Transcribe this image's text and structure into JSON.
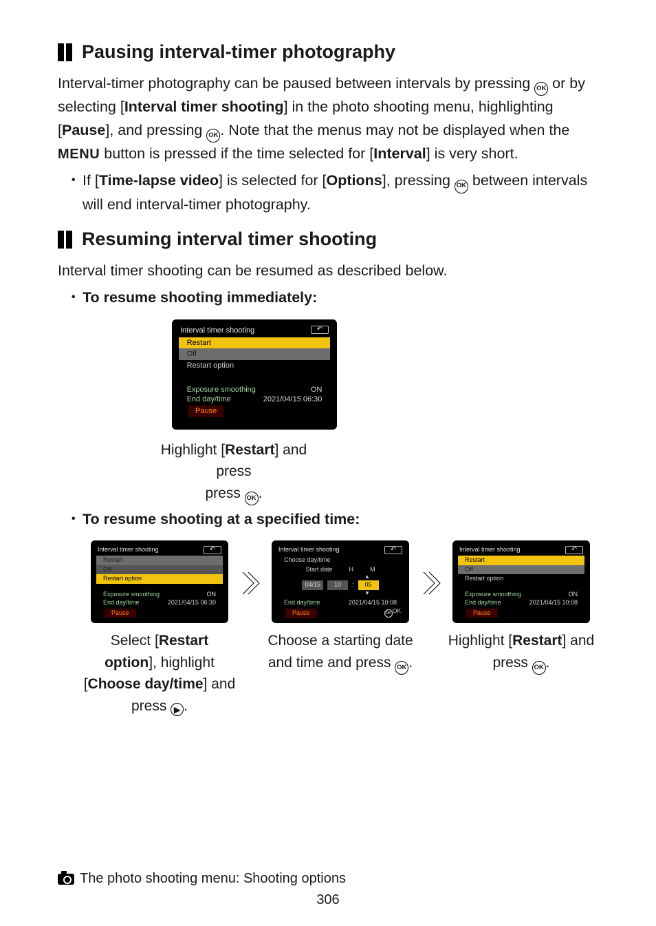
{
  "section1": {
    "heading": "Pausing interval-timer photography",
    "para_main": {
      "seg1": "Interval-timer photography can be paused between intervals by pressing ",
      "ok1": "OK",
      "seg2": " or by selecting [",
      "b1": "Interval timer shooting",
      "seg3": "] in the photo shooting menu, highlighting [",
      "b2": "Pause",
      "seg4": "], and pressing ",
      "ok2": "OK",
      "seg5": ". Note that the menus may not be displayed when the ",
      "menu": "MENU",
      "seg6": " button is pressed if the time selected for [",
      "b3": "Interval",
      "seg7": "] is very short."
    },
    "bullet1": {
      "seg1": "If [",
      "b1": "Time-lapse video",
      "seg2": "] is selected for [",
      "b2": "Options",
      "seg3": "], pressing ",
      "ok": "OK",
      "seg4": " between intervals will end interval-timer photography."
    }
  },
  "section2": {
    "heading": "Resuming interval timer shooting",
    "intro": "Interval timer shooting can be resumed as described below.",
    "bullet_immediate": "To resume shooting immediately:",
    "bullet_specified": "To resume shooting at a specified time:",
    "caption_large": {
      "seg1": "Highlight [",
      "b1": "Restart",
      "seg2": "] and press ",
      "ok": "OK",
      "seg3": "."
    },
    "cap1": {
      "seg1": "Select [",
      "b1": "Restart option",
      "seg2": "], highlight [",
      "b2": "Choose day/time",
      "seg3": "] and press ",
      "icon": "▶",
      "seg4": "."
    },
    "cap2": {
      "seg1": "Choose a starting date and time and press ",
      "ok": "OK",
      "seg2": "."
    },
    "cap3": {
      "seg1": "Highlight [",
      "b1": "Restart",
      "seg2": "] and press ",
      "ok": "OK",
      "seg3": "."
    }
  },
  "lcd_common": {
    "title": "Interval timer shooting",
    "back": "↶",
    "restart": "Restart",
    "off": "Off",
    "restart_option": "Restart option",
    "exposure_smoothing": "Exposure smoothing",
    "on": "ON",
    "end_day_time": "End day/time",
    "pause": "Pause"
  },
  "lcd_large": {
    "end_value": "2021/04/15 06:30"
  },
  "lcd_s1": {
    "end_value": "2021/04/15 06:30",
    "chevron": "▶"
  },
  "lcd_s2": {
    "choose": "Choose day/time",
    "start_date": "Start date",
    "h": "H",
    "m": "M",
    "date_val": "04/15",
    "h_val": "10",
    "colon": ":",
    "m_val": "05",
    "tri_up": "▲",
    "tri_dn": "▼",
    "end_value": "2021/04/15 10:08",
    "okok": "OK"
  },
  "lcd_s3": {
    "end_value": "2021/04/15 10:08"
  },
  "footer": {
    "text": "The photo shooting menu: Shooting options",
    "page": "306"
  }
}
